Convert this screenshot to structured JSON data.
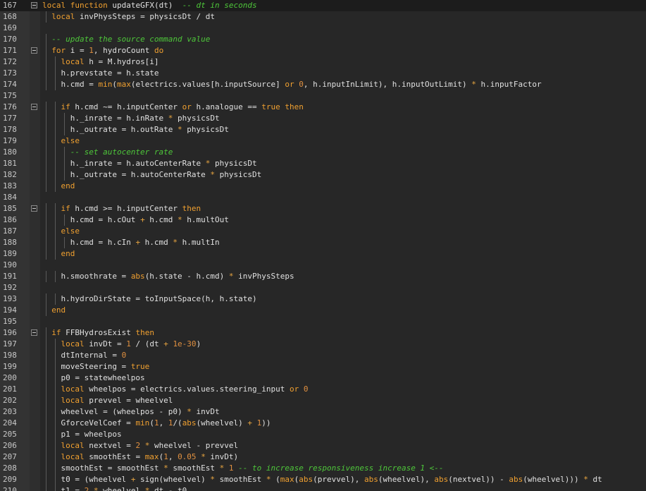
{
  "editor": {
    "language": "lua",
    "current_line_number": "167",
    "colors": {
      "background": "#272727",
      "gutter": "#333333",
      "keyword": "#f0a030",
      "comment": "#4ec73a",
      "text": "#d4d4d4"
    },
    "lines": [
      {
        "num": "167",
        "indent": 0,
        "fold": true,
        "current": true,
        "tokens": [
          [
            "k",
            "local function"
          ],
          [
            "t",
            " updateGFX(dt)  "
          ],
          [
            "c",
            "-- dt in seconds"
          ]
        ]
      },
      {
        "num": "168",
        "indent": 2,
        "fold": false,
        "tokens": [
          [
            "k",
            "local"
          ],
          [
            "t",
            " invPhysSteps = physicsDt / dt"
          ]
        ]
      },
      {
        "num": "169",
        "indent": 0,
        "fold": false,
        "tokens": []
      },
      {
        "num": "170",
        "indent": 2,
        "fold": false,
        "tokens": [
          [
            "c",
            "-- update the source command value"
          ]
        ]
      },
      {
        "num": "171",
        "indent": 2,
        "fold": true,
        "tokens": [
          [
            "k",
            "for"
          ],
          [
            "t",
            " i = "
          ],
          [
            "n",
            "1"
          ],
          [
            "t",
            ", hydroCount "
          ],
          [
            "k",
            "do"
          ]
        ]
      },
      {
        "num": "172",
        "indent": 4,
        "fold": false,
        "tokens": [
          [
            "k",
            "local"
          ],
          [
            "t",
            " h = M.hydros[i]"
          ]
        ]
      },
      {
        "num": "173",
        "indent": 4,
        "fold": false,
        "tokens": [
          [
            "t",
            "h.prevstate = h.state"
          ]
        ]
      },
      {
        "num": "174",
        "indent": 4,
        "fold": false,
        "tokens": [
          [
            "t",
            "h.cmd = "
          ],
          [
            "f",
            "min"
          ],
          [
            "t",
            "("
          ],
          [
            "f",
            "max"
          ],
          [
            "t",
            "(electrics.values[h.inputSource] "
          ],
          [
            "k",
            "or"
          ],
          [
            "t",
            " "
          ],
          [
            "n",
            "0"
          ],
          [
            "t",
            ", h.inputInLimit), h.inputOutLimit) "
          ],
          [
            "o",
            "*"
          ],
          [
            "t",
            " h.inputFactor"
          ]
        ]
      },
      {
        "num": "175",
        "indent": 0,
        "fold": false,
        "tokens": []
      },
      {
        "num": "176",
        "indent": 4,
        "fold": true,
        "tokens": [
          [
            "k",
            "if"
          ],
          [
            "t",
            " h.cmd ~= h.inputCenter "
          ],
          [
            "k",
            "or"
          ],
          [
            "t",
            " h.analogue == "
          ],
          [
            "k",
            "true"
          ],
          [
            "t",
            " "
          ],
          [
            "k",
            "then"
          ]
        ]
      },
      {
        "num": "177",
        "indent": 6,
        "fold": false,
        "tokens": [
          [
            "t",
            "h._inrate = h.inRate "
          ],
          [
            "o",
            "*"
          ],
          [
            "t",
            " physicsDt"
          ]
        ]
      },
      {
        "num": "178",
        "indent": 6,
        "fold": false,
        "tokens": [
          [
            "t",
            "h._outrate = h.outRate "
          ],
          [
            "o",
            "*"
          ],
          [
            "t",
            " physicsDt"
          ]
        ]
      },
      {
        "num": "179",
        "indent": 4,
        "fold": false,
        "tokens": [
          [
            "k",
            "else"
          ]
        ]
      },
      {
        "num": "180",
        "indent": 6,
        "fold": false,
        "tokens": [
          [
            "c",
            "-- set autocenter rate"
          ]
        ]
      },
      {
        "num": "181",
        "indent": 6,
        "fold": false,
        "tokens": [
          [
            "t",
            "h._inrate = h.autoCenterRate "
          ],
          [
            "o",
            "*"
          ],
          [
            "t",
            " physicsDt"
          ]
        ]
      },
      {
        "num": "182",
        "indent": 6,
        "fold": false,
        "tokens": [
          [
            "t",
            "h._outrate = h.autoCenterRate "
          ],
          [
            "o",
            "*"
          ],
          [
            "t",
            " physicsDt"
          ]
        ]
      },
      {
        "num": "183",
        "indent": 4,
        "fold": false,
        "tokens": [
          [
            "k",
            "end"
          ]
        ]
      },
      {
        "num": "184",
        "indent": 0,
        "fold": false,
        "tokens": []
      },
      {
        "num": "185",
        "indent": 4,
        "fold": true,
        "tokens": [
          [
            "k",
            "if"
          ],
          [
            "t",
            " h.cmd >= h.inputCenter "
          ],
          [
            "k",
            "then"
          ]
        ]
      },
      {
        "num": "186",
        "indent": 6,
        "fold": false,
        "tokens": [
          [
            "t",
            "h.cmd = h.cOut "
          ],
          [
            "o",
            "+"
          ],
          [
            "t",
            " h.cmd "
          ],
          [
            "o",
            "*"
          ],
          [
            "t",
            " h.multOut"
          ]
        ]
      },
      {
        "num": "187",
        "indent": 4,
        "fold": false,
        "tokens": [
          [
            "k",
            "else"
          ]
        ]
      },
      {
        "num": "188",
        "indent": 6,
        "fold": false,
        "tokens": [
          [
            "t",
            "h.cmd = h.cIn "
          ],
          [
            "o",
            "+"
          ],
          [
            "t",
            " h.cmd "
          ],
          [
            "o",
            "*"
          ],
          [
            "t",
            " h.multIn"
          ]
        ]
      },
      {
        "num": "189",
        "indent": 4,
        "fold": false,
        "tokens": [
          [
            "k",
            "end"
          ]
        ]
      },
      {
        "num": "190",
        "indent": 0,
        "fold": false,
        "tokens": []
      },
      {
        "num": "191",
        "indent": 4,
        "fold": false,
        "tokens": [
          [
            "t",
            "h.smoothrate = "
          ],
          [
            "f",
            "abs"
          ],
          [
            "t",
            "(h.state - h.cmd) "
          ],
          [
            "o",
            "*"
          ],
          [
            "t",
            " invPhysSteps"
          ]
        ]
      },
      {
        "num": "192",
        "indent": 0,
        "fold": false,
        "tokens": []
      },
      {
        "num": "193",
        "indent": 4,
        "fold": false,
        "tokens": [
          [
            "t",
            "h.hydroDirState = toInputSpace(h, h.state)"
          ]
        ]
      },
      {
        "num": "194",
        "indent": 2,
        "fold": false,
        "tokens": [
          [
            "k",
            "end"
          ]
        ]
      },
      {
        "num": "195",
        "indent": 0,
        "fold": false,
        "tokens": []
      },
      {
        "num": "196",
        "indent": 2,
        "fold": true,
        "tokens": [
          [
            "k",
            "if"
          ],
          [
            "t",
            " FFBHydrosExist "
          ],
          [
            "k",
            "then"
          ]
        ]
      },
      {
        "num": "197",
        "indent": 4,
        "fold": false,
        "tokens": [
          [
            "k",
            "local"
          ],
          [
            "t",
            " invDt = "
          ],
          [
            "n",
            "1"
          ],
          [
            "t",
            " / (dt "
          ],
          [
            "o",
            "+"
          ],
          [
            "t",
            " "
          ],
          [
            "n",
            "1e-30"
          ],
          [
            "t",
            ")"
          ]
        ]
      },
      {
        "num": "198",
        "indent": 4,
        "fold": false,
        "tokens": [
          [
            "t",
            "dtInternal = "
          ],
          [
            "n",
            "0"
          ]
        ]
      },
      {
        "num": "199",
        "indent": 4,
        "fold": false,
        "tokens": [
          [
            "t",
            "moveSteering = "
          ],
          [
            "k",
            "true"
          ]
        ]
      },
      {
        "num": "200",
        "indent": 4,
        "fold": false,
        "tokens": [
          [
            "t",
            "p0 = statewheelpos"
          ]
        ]
      },
      {
        "num": "201",
        "indent": 4,
        "fold": false,
        "tokens": [
          [
            "k",
            "local"
          ],
          [
            "t",
            " wheelpos = electrics.values.steering_input "
          ],
          [
            "k",
            "or"
          ],
          [
            "t",
            " "
          ],
          [
            "n",
            "0"
          ]
        ]
      },
      {
        "num": "202",
        "indent": 4,
        "fold": false,
        "tokens": [
          [
            "k",
            "local"
          ],
          [
            "t",
            " prevvel = wheelvel"
          ]
        ]
      },
      {
        "num": "203",
        "indent": 4,
        "fold": false,
        "tokens": [
          [
            "t",
            "wheelvel = (wheelpos - p0) "
          ],
          [
            "o",
            "*"
          ],
          [
            "t",
            " invDt"
          ]
        ]
      },
      {
        "num": "204",
        "indent": 4,
        "fold": false,
        "tokens": [
          [
            "t",
            "GforceVelCoef = "
          ],
          [
            "f",
            "min"
          ],
          [
            "t",
            "("
          ],
          [
            "n",
            "1"
          ],
          [
            "t",
            ", "
          ],
          [
            "n",
            "1"
          ],
          [
            "t",
            "/("
          ],
          [
            "f",
            "abs"
          ],
          [
            "t",
            "(wheelvel) "
          ],
          [
            "o",
            "+"
          ],
          [
            "t",
            " "
          ],
          [
            "n",
            "1"
          ],
          [
            "t",
            "))"
          ]
        ]
      },
      {
        "num": "205",
        "indent": 4,
        "fold": false,
        "tokens": [
          [
            "t",
            "p1 = wheelpos"
          ]
        ]
      },
      {
        "num": "206",
        "indent": 4,
        "fold": false,
        "tokens": [
          [
            "k",
            "local"
          ],
          [
            "t",
            " nextvel = "
          ],
          [
            "n",
            "2"
          ],
          [
            "t",
            " "
          ],
          [
            "o",
            "*"
          ],
          [
            "t",
            " wheelvel - prevvel"
          ]
        ]
      },
      {
        "num": "207",
        "indent": 4,
        "fold": false,
        "tokens": [
          [
            "k",
            "local"
          ],
          [
            "t",
            " smoothEst = "
          ],
          [
            "f",
            "max"
          ],
          [
            "t",
            "("
          ],
          [
            "n",
            "1"
          ],
          [
            "t",
            ", "
          ],
          [
            "n",
            "0.05"
          ],
          [
            "t",
            " "
          ],
          [
            "o",
            "*"
          ],
          [
            "t",
            " invDt)"
          ]
        ]
      },
      {
        "num": "208",
        "indent": 4,
        "fold": false,
        "tokens": [
          [
            "t",
            "smoothEst = smoothEst "
          ],
          [
            "o",
            "*"
          ],
          [
            "t",
            " smoothEst "
          ],
          [
            "o",
            "*"
          ],
          [
            "t",
            " "
          ],
          [
            "n",
            "1"
          ],
          [
            "t",
            " "
          ],
          [
            "c",
            "-- to increase responsiveness increase 1 <--"
          ]
        ]
      },
      {
        "num": "209",
        "indent": 4,
        "fold": false,
        "tokens": [
          [
            "t",
            "t0 = (wheelvel "
          ],
          [
            "o",
            "+"
          ],
          [
            "t",
            " sign(wheelvel) "
          ],
          [
            "o",
            "*"
          ],
          [
            "t",
            " smoothEst "
          ],
          [
            "o",
            "*"
          ],
          [
            "t",
            " ("
          ],
          [
            "f",
            "max"
          ],
          [
            "t",
            "("
          ],
          [
            "f",
            "abs"
          ],
          [
            "t",
            "(prevvel), "
          ],
          [
            "f",
            "abs"
          ],
          [
            "t",
            "(wheelvel), "
          ],
          [
            "f",
            "abs"
          ],
          [
            "t",
            "(nextvel)) - "
          ],
          [
            "f",
            "abs"
          ],
          [
            "t",
            "(wheelvel))) "
          ],
          [
            "o",
            "*"
          ],
          [
            "t",
            " dt"
          ]
        ]
      },
      {
        "num": "210",
        "indent": 4,
        "fold": false,
        "tokens": [
          [
            "t",
            "t1 = "
          ],
          [
            "n",
            "2"
          ],
          [
            "t",
            " "
          ],
          [
            "o",
            "*"
          ],
          [
            "t",
            " wheelvel "
          ],
          [
            "o",
            "*"
          ],
          [
            "t",
            " dt - t0"
          ]
        ]
      }
    ]
  }
}
